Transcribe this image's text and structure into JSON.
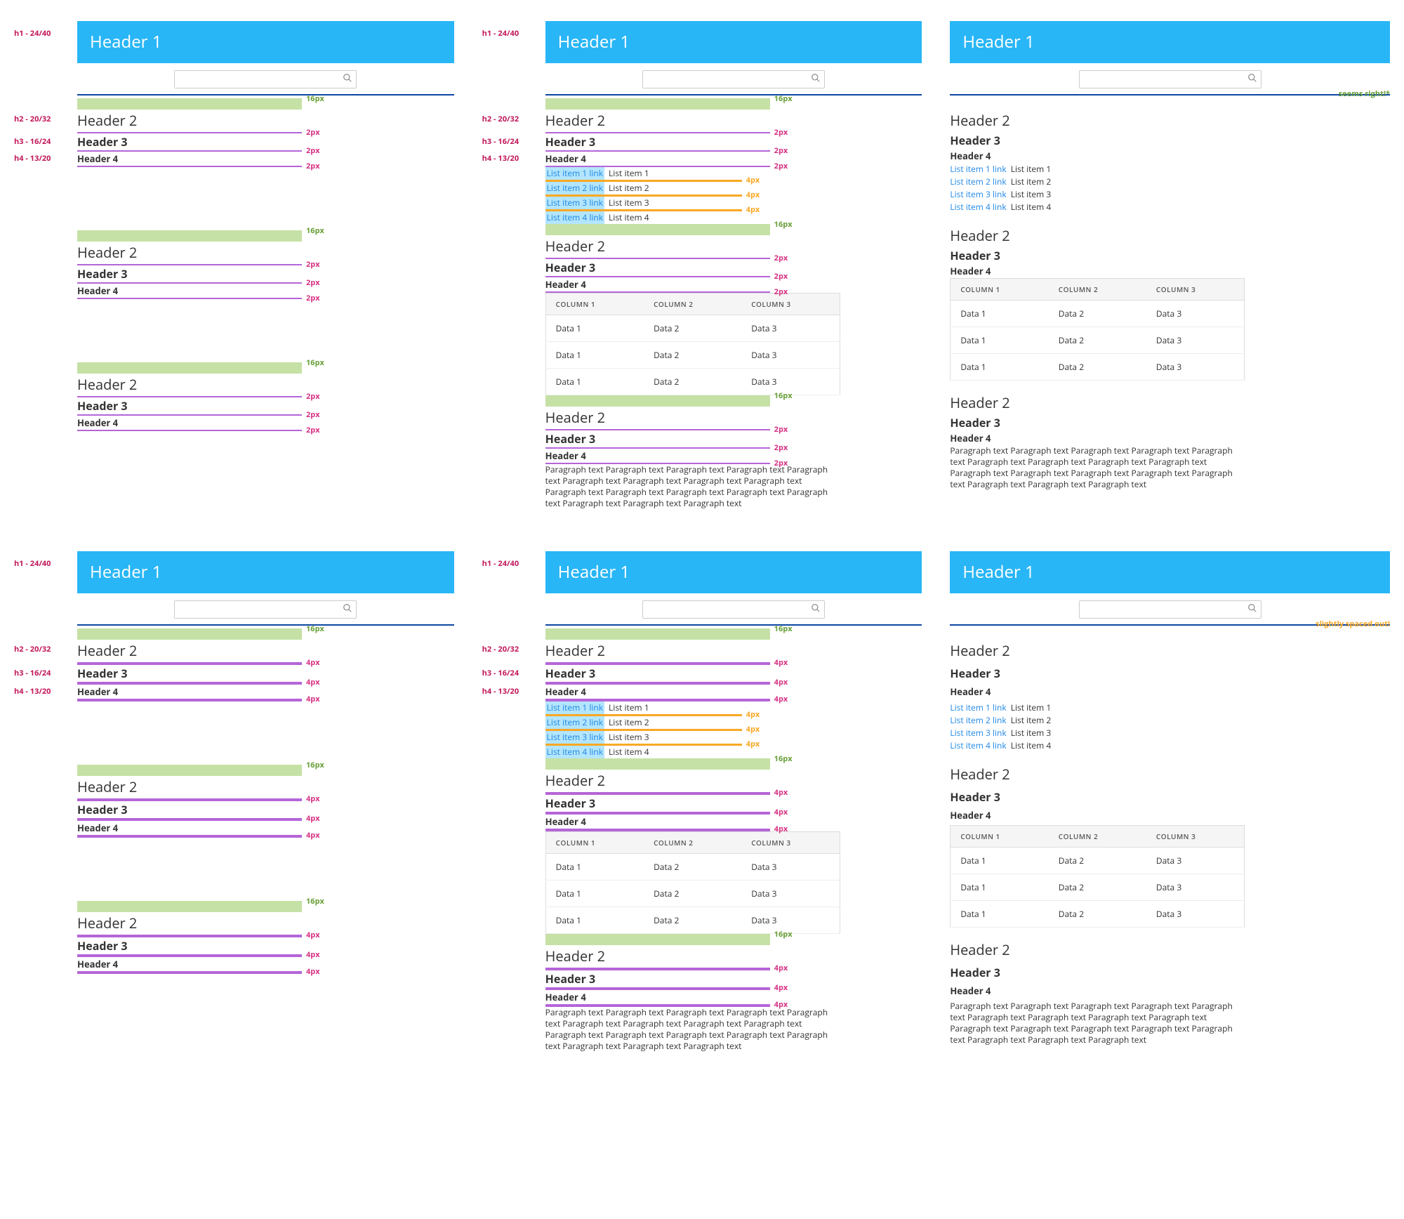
{
  "typo": {
    "h1": "h1 - 24/40",
    "h2": "h2 - 20/32",
    "h3": "h3 - 16/24",
    "h4": "h4 - 13/20"
  },
  "banner": {
    "title": "Header 1"
  },
  "search": {
    "placeholder": ""
  },
  "headers": {
    "h2": "Header 2",
    "h3": "Header 3",
    "h4": "Header 4"
  },
  "spacing": {
    "gap16": "16px",
    "gap2": "2px",
    "gap4": "4px"
  },
  "list": {
    "items": [
      {
        "link": "List item 1 link",
        "text": "List item 1"
      },
      {
        "link": "List item 2 link",
        "text": "List item 2"
      },
      {
        "link": "List item 3 link",
        "text": "List item 3"
      },
      {
        "link": "List item 4 link",
        "text": "List item 4"
      }
    ]
  },
  "table": {
    "cols": [
      "COLUMN 1",
      "COLUMN 2",
      "COLUMN 3"
    ],
    "rows": [
      [
        "Data 1",
        "Data 2",
        "Data 3"
      ],
      [
        "Data 1",
        "Data 2",
        "Data 3"
      ],
      [
        "Data 1",
        "Data 2",
        "Data 3"
      ]
    ]
  },
  "paragraph": "Paragraph text Paragraph text Paragraph text Paragraph text Paragraph text Paragraph text Paragraph text Paragraph text Paragraph text Paragraph text Paragraph text Paragraph text Paragraph text Paragraph text Paragraph text Paragraph text Paragraph text",
  "badges": {
    "ok": "seems right!*",
    "spaced": "slightly spaced out!"
  }
}
